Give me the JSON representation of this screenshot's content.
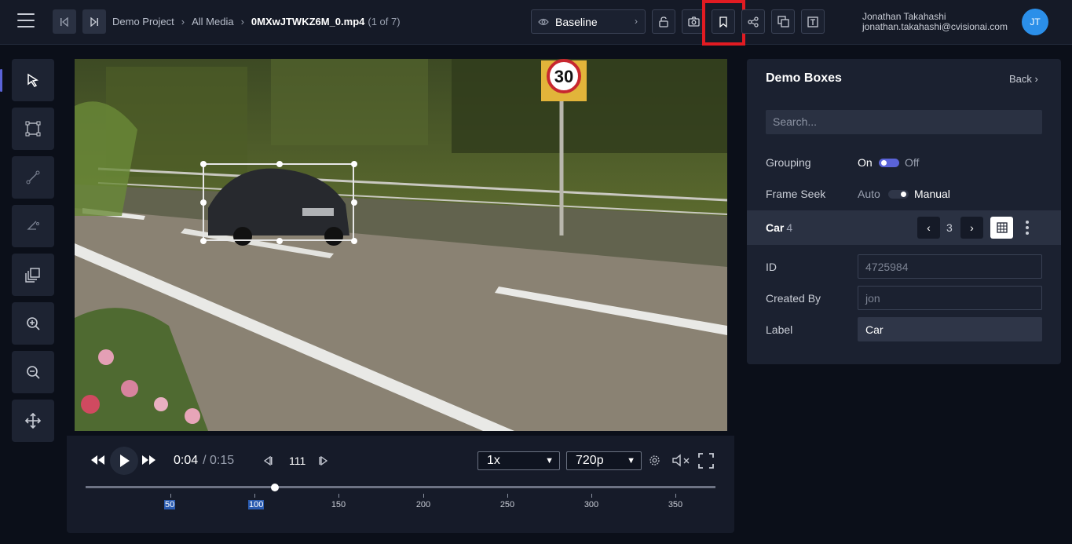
{
  "breadcrumb": {
    "project": "Demo Project",
    "media": "All Media",
    "file": "0MXwJTWKZ6M_0.mp4",
    "position": "(1 of 7)"
  },
  "view_selector": {
    "label": "Baseline"
  },
  "user": {
    "name": "Jonathan Takahashi",
    "email": "jonathan.takahashi@cvisionai.com",
    "initials": "JT"
  },
  "player": {
    "current_time": "0:04",
    "duration": "/ 0:15",
    "frame": "111",
    "speed": "1x",
    "quality": "720p",
    "progress_fraction": 0.3,
    "timeline_ticks": [
      "50",
      "100",
      "150",
      "200",
      "250",
      "300",
      "350"
    ]
  },
  "panel": {
    "title": "Demo Boxes",
    "back_label": "Back",
    "search_placeholder": "Search...",
    "grouping_label": "Grouping",
    "grouping_on": "On",
    "grouping_off": "Off",
    "frame_seek_label": "Frame Seek",
    "frame_seek_auto": "Auto",
    "frame_seek_manual": "Manual",
    "entity": {
      "type": "Car",
      "count": "4",
      "index": "3"
    },
    "fields": {
      "id_label": "ID",
      "id_value": "4725984",
      "created_by_label": "Created By",
      "created_by_value": "jon",
      "label_label": "Label",
      "label_value": "Car"
    }
  },
  "colors": {
    "accent": "#5a63d8",
    "highlight": "#e11b22",
    "avatar": "#2b8fe9"
  }
}
